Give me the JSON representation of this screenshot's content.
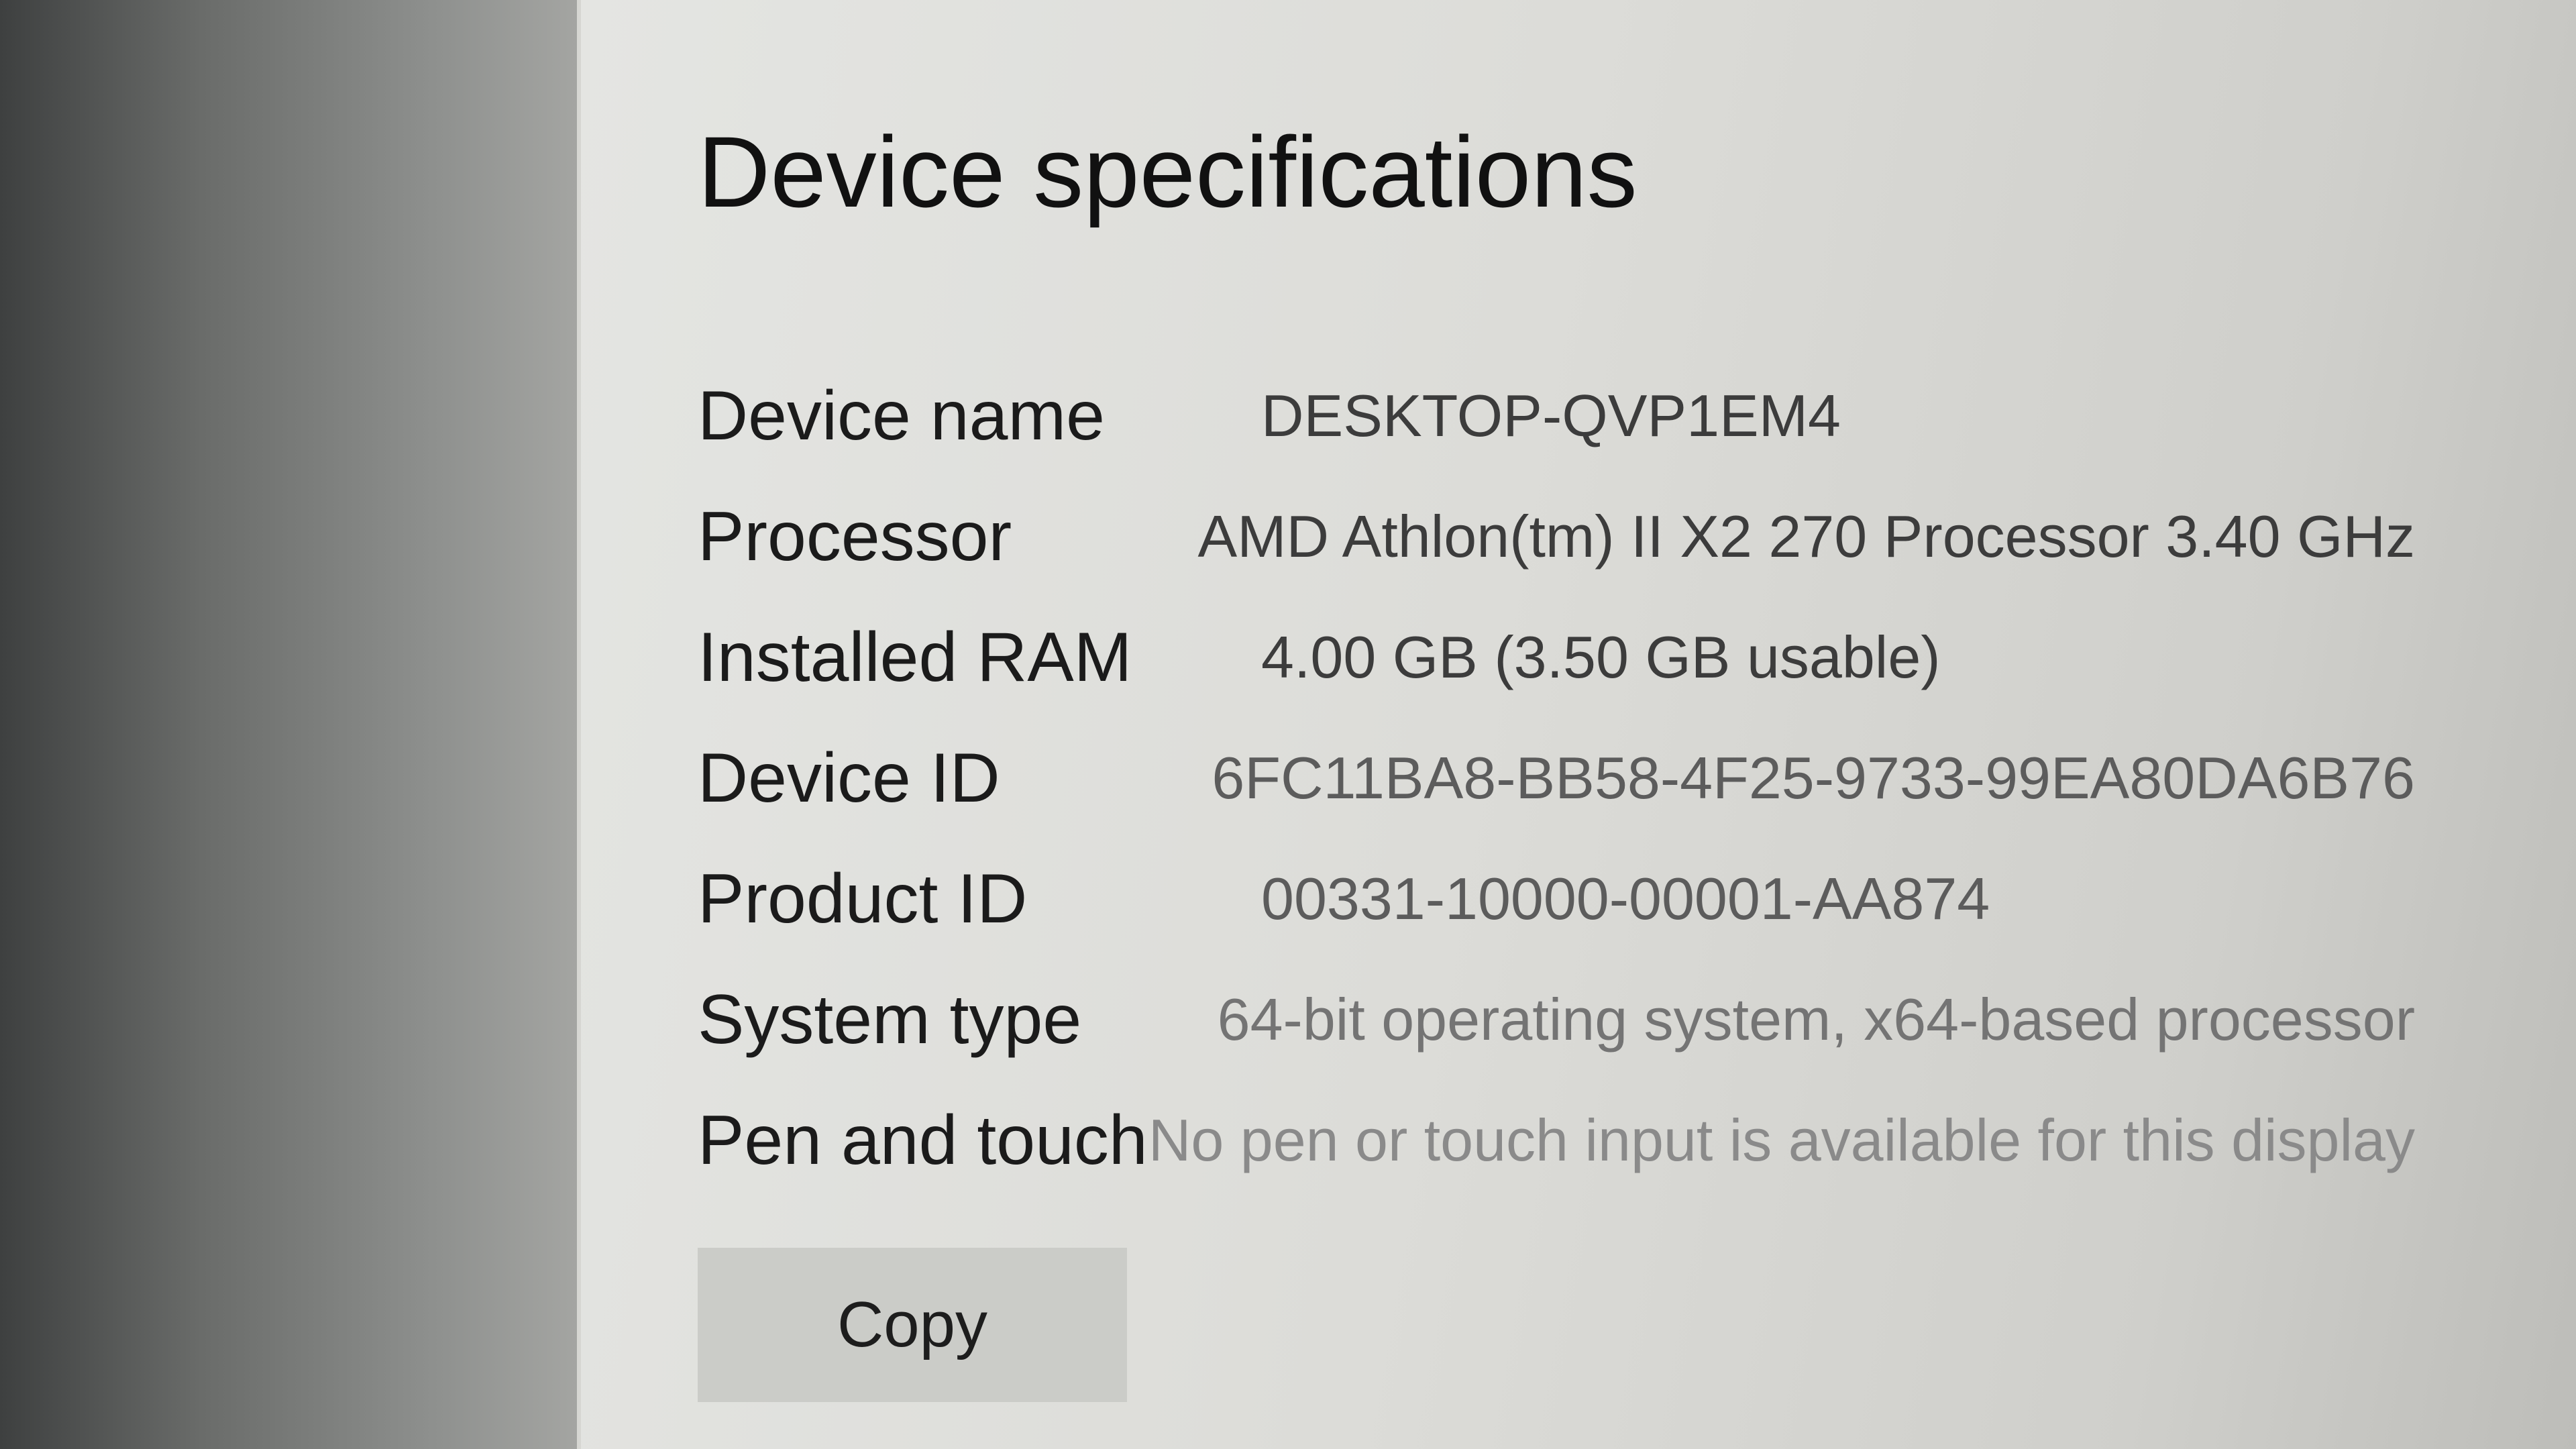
{
  "section": {
    "title": "Device specifications"
  },
  "specs": [
    {
      "label": "Device name",
      "value": "DESKTOP-QVP1EM4"
    },
    {
      "label": "Processor",
      "value": "AMD Athlon(tm) II X2 270 Processor   3.40 GHz"
    },
    {
      "label": "Installed RAM",
      "value": "4.00 GB (3.50 GB usable)"
    },
    {
      "label": "Device ID",
      "value": "6FC11BA8-BB58-4F25-9733-99EA80DA6B76"
    },
    {
      "label": "Product ID",
      "value": "00331-10000-00001-AA874"
    },
    {
      "label": "System type",
      "value": "64-bit operating system, x64-based processor"
    },
    {
      "label": "Pen and touch",
      "value": "No pen or touch input is available for this display"
    }
  ],
  "actions": {
    "copy_label": "Copy"
  }
}
